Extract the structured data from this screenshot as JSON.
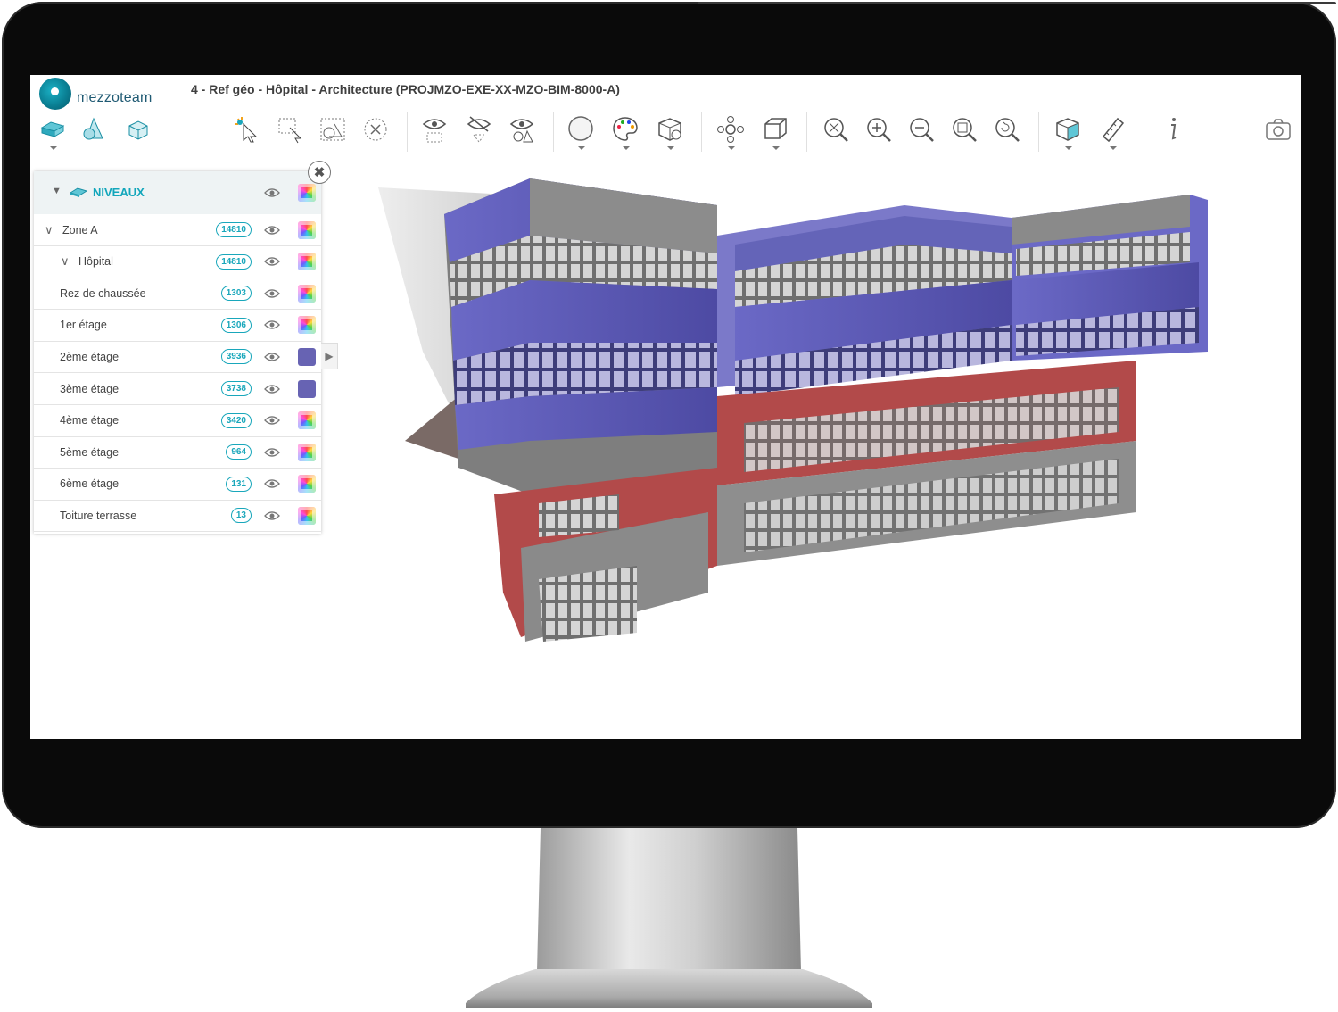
{
  "app": {
    "logo_text": "mezzoteam",
    "title": "4 - Ref géo - Hôpital - Architecture (PROJMZO-EXE-XX-MZO-BIM-8000-A)"
  },
  "toolbar": {
    "tools": [
      {
        "name": "levels-tool-icon"
      },
      {
        "name": "shapes-tool-icon"
      },
      {
        "name": "objects-tool-icon"
      },
      {
        "name": "select-tool-icon"
      },
      {
        "name": "box-select-icon"
      },
      {
        "name": "select-shapes-icon"
      },
      {
        "name": "clear-selection-icon"
      },
      {
        "name": "show-icon"
      },
      {
        "name": "hide-icon"
      },
      {
        "name": "isolate-icon"
      },
      {
        "name": "sphere-icon"
      },
      {
        "name": "palette-icon"
      },
      {
        "name": "cube-play-icon"
      },
      {
        "name": "navigate-icon"
      },
      {
        "name": "box-icon"
      },
      {
        "name": "zoom-fit-icon"
      },
      {
        "name": "zoom-in-icon"
      },
      {
        "name": "zoom-out-icon"
      },
      {
        "name": "zoom-window-icon"
      },
      {
        "name": "zoom-reset-icon"
      },
      {
        "name": "section-box-icon"
      },
      {
        "name": "measure-icon"
      },
      {
        "name": "info-icon"
      },
      {
        "name": "camera-icon"
      }
    ]
  },
  "levels_panel": {
    "title": "NIVEAUX",
    "rows": [
      {
        "label": "Zone A",
        "count": "14810",
        "color": "rainbow",
        "expandable": true
      },
      {
        "label": "Hôpital",
        "count": "14810",
        "color": "rainbow",
        "expandable": true
      },
      {
        "label": "Rez de chaussée",
        "count": "1303",
        "color": "rainbow"
      },
      {
        "label": "1er étage",
        "count": "1306",
        "color": "rainbow"
      },
      {
        "label": "2ème étage",
        "count": "3936",
        "color": "#6763b3"
      },
      {
        "label": "3ème étage",
        "count": "3738",
        "color": "#6763b3"
      },
      {
        "label": "4ème étage",
        "count": "3420",
        "color": "rainbow"
      },
      {
        "label": "5ème étage",
        "count": "964",
        "color": "rainbow"
      },
      {
        "label": "6ème étage",
        "count": "131",
        "color": "rainbow"
      },
      {
        "label": "Toiture terrasse",
        "count": "13",
        "color": "rainbow"
      }
    ]
  },
  "colors": {
    "accent": "#19a7bb",
    "facade_purple": "#5b59b0",
    "brick_red": "#b24a4a",
    "concrete_grey": "#8c8c8c"
  }
}
